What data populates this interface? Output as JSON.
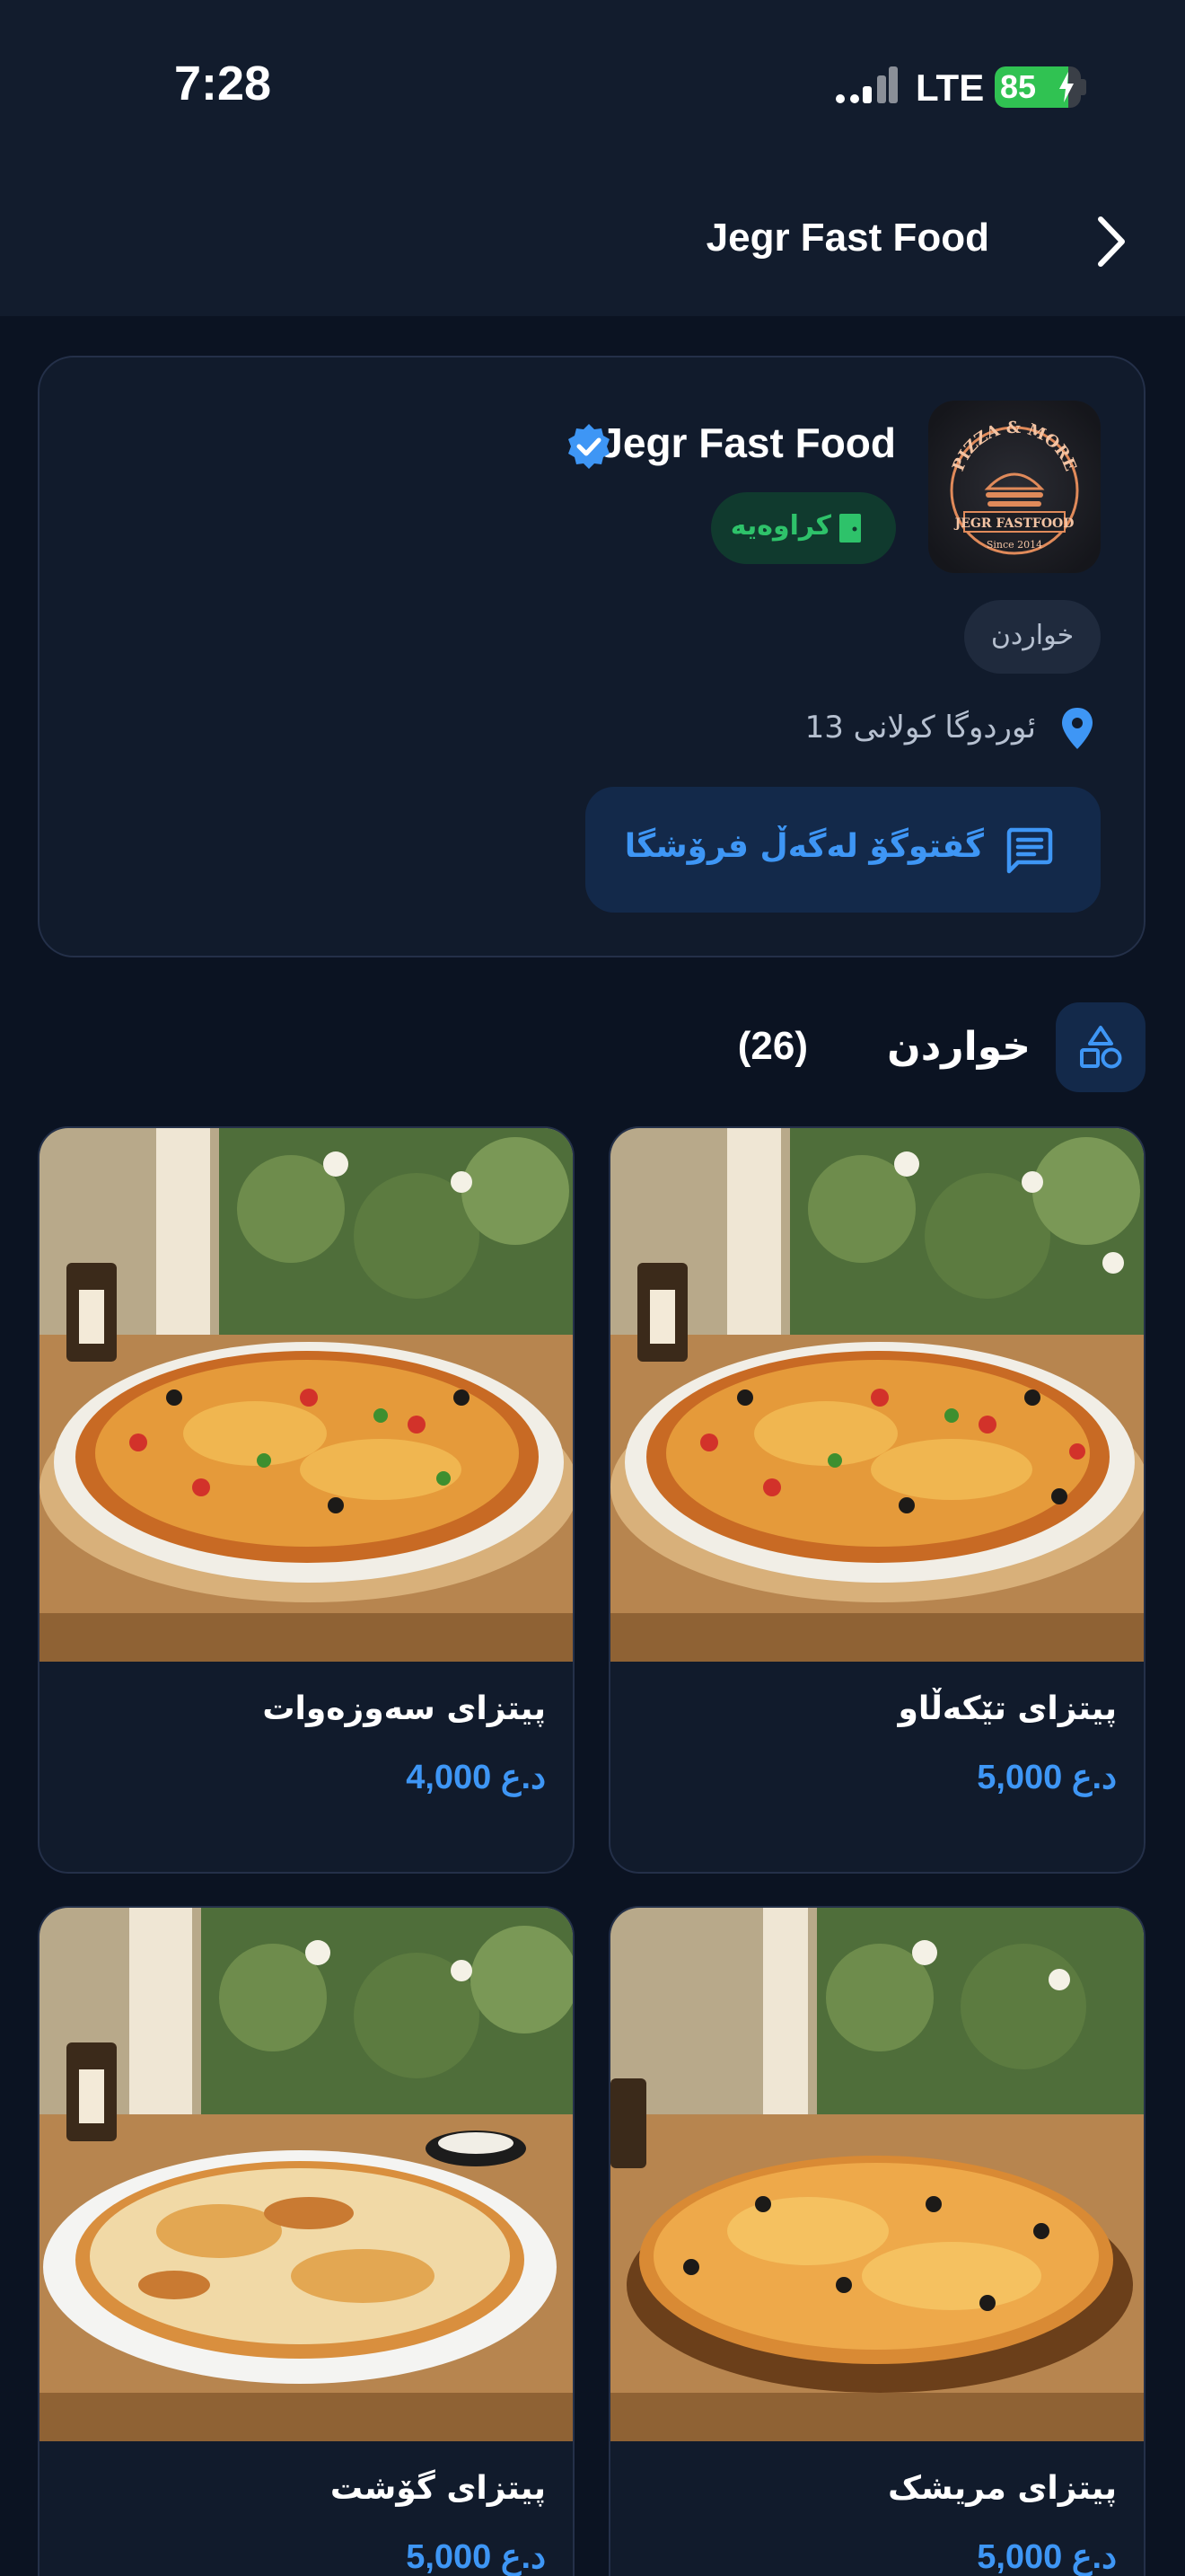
{
  "status_bar": {
    "time": "7:28",
    "network": "LTE",
    "battery_text": "85",
    "battery_level": 0.85
  },
  "header": {
    "title": "Jegr Fast Food"
  },
  "shop": {
    "name": "Jegr Fast Food",
    "logo_text_top": "PIZZA & MORE",
    "logo_text_mid": "JEGR FASTFOOD",
    "logo_text_bottom": "Since 2014",
    "open_status": "کراوەیە",
    "category": "خواردن",
    "address": "ئوردوگا کولانی 13",
    "chat_label": "گفتوگۆ لەگەڵ فرۆشگا"
  },
  "section": {
    "title": "خواردن",
    "count": "(26)"
  },
  "products": [
    {
      "name": "پیتزای تێکەڵاو",
      "price": "5,000 د.ع"
    },
    {
      "name": "پیتزای سەوزەوات",
      "price": "4,000 د.ع"
    },
    {
      "name": "پیتزای مریشک",
      "price": "5,000 د.ع"
    },
    {
      "name": "پیتزای گۆشت",
      "price": "5,000 د.ع"
    }
  ],
  "colors": {
    "background": "#0b1322",
    "card": "#111b2c",
    "accent": "#3e96f5",
    "open_green": "#2ec26a",
    "battery_green": "#30c252"
  }
}
